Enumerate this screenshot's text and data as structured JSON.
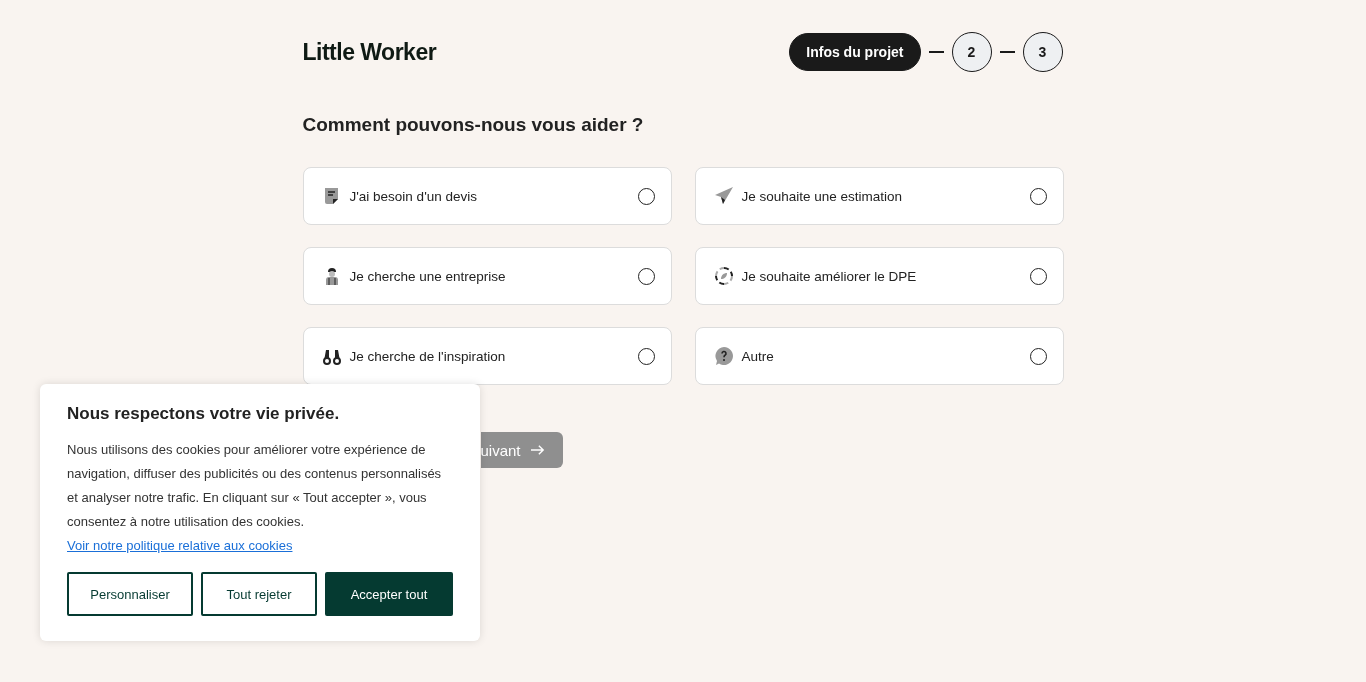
{
  "logo": "Little Worker",
  "steps": [
    {
      "label": "Infos du projet",
      "selected": true
    },
    {
      "label": "2",
      "selected": false
    },
    {
      "label": "3",
      "selected": false
    }
  ],
  "question": "Comment pouvons-nous vous aider ?",
  "options": [
    {
      "label": "J'ai besoin d'un devis",
      "selected": false
    },
    {
      "label": "Je souhaite une estimation",
      "selected": false
    },
    {
      "label": "Je cherche une entreprise",
      "selected": false
    },
    {
      "label": "Je souhaite améliorer le DPE",
      "selected": false
    },
    {
      "label": "Je cherche de l'inspiration",
      "selected": false
    },
    {
      "label": "Autre",
      "selected": false
    }
  ],
  "next_button": {
    "label": "uivant",
    "disabled": true
  },
  "cookie_banner": {
    "title": "Nous respectons votre vie privée.",
    "text": "Nous utilisons des cookies pour améliorer votre expérience de navigation, diffuser des publicités ou des contenus personnalisés et analyser notre trafic. En cliquant sur « Tout accepter », vous consentez à notre utilisation des cookies.",
    "link": "Voir notre politique relative aux cookies",
    "buttons": [
      {
        "label": "Personnaliser",
        "kind": "outline"
      },
      {
        "label": "Tout rejeter",
        "kind": "outline"
      },
      {
        "label": "Accepter tout",
        "kind": "filled"
      }
    ]
  }
}
